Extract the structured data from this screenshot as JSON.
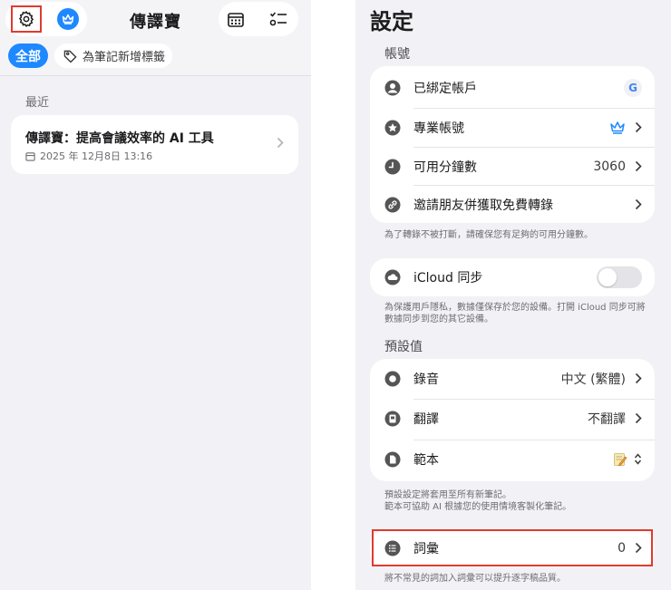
{
  "left": {
    "app_title": "傳譯寶",
    "filters": {
      "all": "全部",
      "add_tag": "為筆記新增標籤"
    },
    "section_recent": "最近",
    "note": {
      "title": "傳譯寶：提高會議效率的 AI 工具",
      "date": "2025 年 12月8日 13:16"
    }
  },
  "settings": {
    "title": "設定",
    "account_section": "帳號",
    "rows": {
      "bound_account": "已綁定帳戶",
      "pro_account": "專業帳號",
      "minutes": "可用分鐘數",
      "minutes_value": "3060",
      "invite": "邀請朋友併獲取免費轉錄"
    },
    "account_footnote": "為了轉錄不被打斷，請確保您有足夠的可用分鐘數。",
    "icloud": {
      "label": "iCloud 同步",
      "enabled": false
    },
    "icloud_footnote": "為保護用戶隱私，數據僅保存於您的設備。打開 iCloud 同步可將數據同步到您的其它設備。",
    "defaults_section": "預設值",
    "defaults": {
      "record": "錄音",
      "record_value": "中文 (繁體)",
      "translate": "翻譯",
      "translate_value": "不翻譯",
      "template": "範本"
    },
    "defaults_footnote_1": "預設設定將套用至所有新筆記。",
    "defaults_footnote_2": "範本可協助 AI 根據您的使用情境客製化筆記。",
    "vocab": {
      "label": "詞彙",
      "value": "0"
    },
    "vocab_footnote": "將不常見的詞加入詞彙可以提升逐字稿品質。"
  },
  "colors": {
    "accent": "#1e88ff",
    "highlight": "#e03a2f",
    "google": "#4285f4"
  }
}
